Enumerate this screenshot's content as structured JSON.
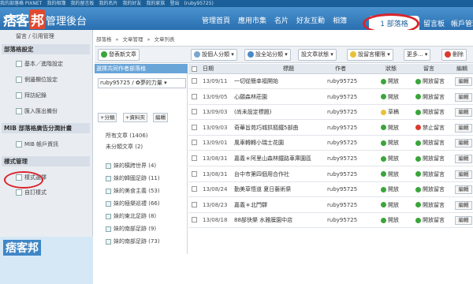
{
  "toplinks": [
    "我的部落格 PIXNET",
    "我的相簿",
    "我的留言板",
    "我的名片",
    "我的好友",
    "我的家族",
    "登出",
    "(ruby95725)"
  ],
  "header": {
    "logo": "痞客",
    "logo_box": "邦",
    "admin_title": "管理後台"
  },
  "nav": {
    "items": [
      "管理首頁",
      "應用市集",
      "名片",
      "好友互動",
      "相簿"
    ],
    "active": "部落格",
    "active_num": "1",
    "after": [
      "留言板",
      "帳戶管理"
    ]
  },
  "sidebar": {
    "top_item": "留言 / 引用管理",
    "sections": [
      {
        "head": "部落格設定",
        "items": [
          "基本／進階設定",
          "側邊欄位設定",
          "拜訪紀錄",
          "匯入匯出備份"
        ]
      },
      {
        "head": "MIB 部落格廣告分潤計畫",
        "items": [
          "MIB 帳戶資訊"
        ]
      },
      {
        "head": "樣式管理",
        "items": [
          "樣式選擇",
          "自訂樣式"
        ]
      }
    ],
    "banner_logo": "痞客邦"
  },
  "breadcrumb": [
    "部落格",
    "»",
    "文章管理",
    "»",
    "文章列表"
  ],
  "toolbar": {
    "new_post": "發表新文章",
    "personal_cat": "設個人分類",
    "site_cat": "設全站分類",
    "post_status": "設文章狀態",
    "msg_perm": "設留言權限",
    "more": "更多...",
    "delete": "刪除"
  },
  "catpanel": {
    "title": "選擇共同作者部落格",
    "select": "ruby95725 / ✿夢的力量",
    "buttons": [
      "+分類",
      "+資料夾",
      "編輯"
    ],
    "items": [
      {
        "label": "所有文章",
        "count": "(1406)"
      },
      {
        "label": "未分類文章",
        "count": "(2)"
      }
    ],
    "categories": [
      {
        "label": "妹的橫跨世界",
        "count": "(4)"
      },
      {
        "label": "妹的韓國足跡",
        "count": "(11)"
      },
      {
        "label": "妹的美食主義",
        "count": "(53)"
      },
      {
        "label": "妹的極樂巡禮",
        "count": "(66)"
      },
      {
        "label": "妹的東北足跡",
        "count": "(8)"
      },
      {
        "label": "妹的南部足跡",
        "count": "(9)"
      },
      {
        "label": "妹的南部足跡",
        "count": "(73)"
      }
    ]
  },
  "table": {
    "headers": {
      "date": "日期",
      "title": "標題",
      "author": "作者",
      "status": "狀態",
      "msg": "留言",
      "edit": "編輯"
    },
    "rows": [
      {
        "date": "13/09/11",
        "title": "一切從簡幸福開始",
        "author": "ruby95725",
        "status": "開放",
        "status_color": "#3aa53a",
        "msg": "開放留言",
        "msg_color": "#3aa53a",
        "edit": "編輯"
      },
      {
        "date": "13/09/05",
        "title": "心願森林莊園",
        "author": "ruby95725",
        "status": "開放",
        "status_color": "#3aa53a",
        "msg": "開放留言",
        "msg_color": "#3aa53a",
        "edit": "編輯"
      },
      {
        "date": "13/09/03",
        "title": "(尚未設定標題)",
        "author": "ruby95725",
        "status": "草稿",
        "status_color": "#e8c13a",
        "msg": "開放留言",
        "msg_color": "#3aa53a",
        "edit": "編輯"
      },
      {
        "date": "13/09/03",
        "title": "奇華旨苑巧城拱摳鐵5部曲",
        "author": "ruby95725",
        "status": "開放",
        "status_color": "#3aa53a",
        "msg": "禁止留言",
        "msg_color": "#d93b2f",
        "edit": "編輯"
      },
      {
        "date": "13/09/01",
        "title": "風車轉轉小瑞士花園",
        "author": "ruby95725",
        "status": "開放",
        "status_color": "#3aa53a",
        "msg": "開放留言",
        "msg_color": "#3aa53a",
        "edit": "編輯"
      },
      {
        "date": "13/08/31",
        "title": "嘉義＊阿里山森林鐵路車庫園區",
        "author": "ruby95725",
        "status": "開放",
        "status_color": "#3aa53a",
        "msg": "開放留言",
        "msg_color": "#3aa53a",
        "edit": "編輯"
      },
      {
        "date": "13/08/31",
        "title": "台中市第四個用合作社",
        "author": "ruby95725",
        "status": "開放",
        "status_color": "#3aa53a",
        "msg": "開放留言",
        "msg_color": "#3aa53a",
        "edit": "編輯"
      },
      {
        "date": "13/08/24",
        "title": "勤美草悟道 夏日藝術祭",
        "author": "ruby95725",
        "status": "開放",
        "status_color": "#3aa53a",
        "msg": "開放留言",
        "msg_color": "#3aa53a",
        "edit": "編輯"
      },
      {
        "date": "13/08/23",
        "title": "嘉義＊北門驛",
        "author": "ruby95725",
        "status": "開放",
        "status_color": "#3aa53a",
        "msg": "開放留言",
        "msg_color": "#3aa53a",
        "edit": "編輯"
      },
      {
        "date": "13/08/18",
        "title": "88部快樂 水雅膜園中店",
        "author": "ruby95725",
        "status": "開放",
        "status_color": "#3aa53a",
        "msg": "開放留言",
        "msg_color": "#3aa53a",
        "edit": "編輯"
      }
    ]
  }
}
